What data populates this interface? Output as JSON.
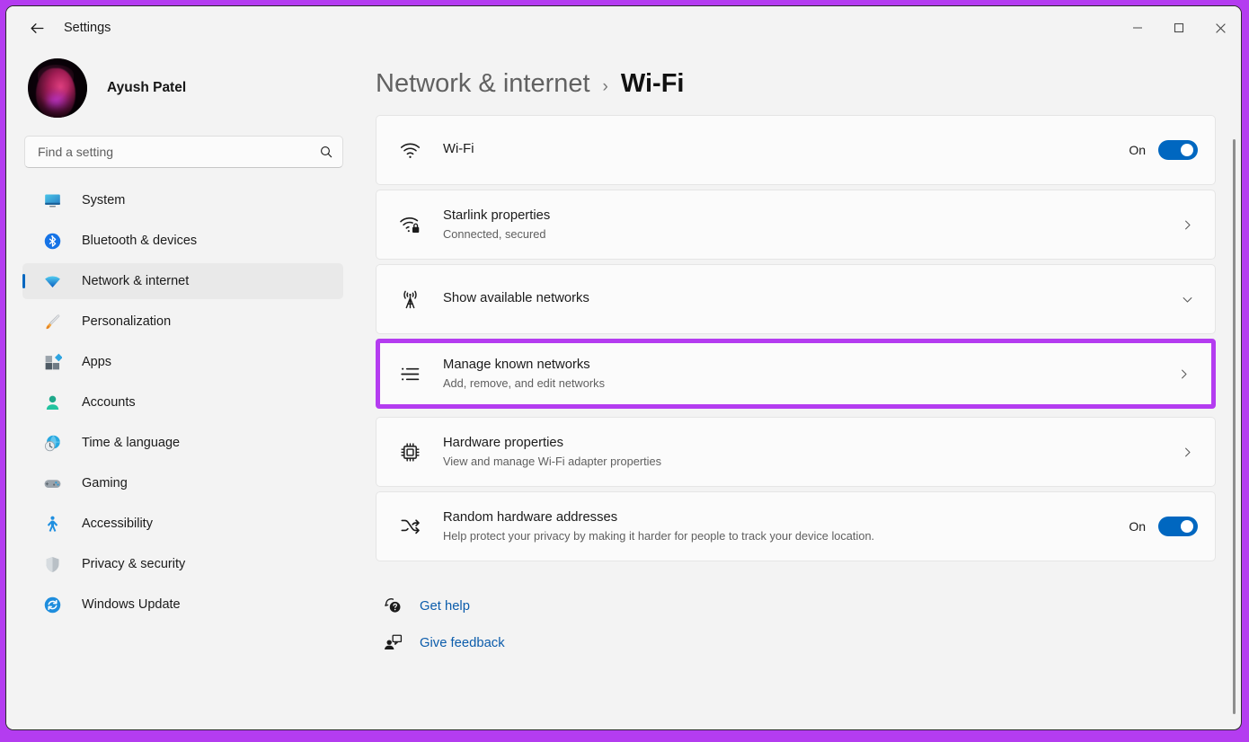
{
  "colors": {
    "highlight_purple": "#b43cf0",
    "accent_blue": "#0067c0",
    "link_blue": "#0b5cab",
    "window_bg": "#f3f3f3",
    "card_bg": "#fbfbfb"
  },
  "titlebar": {
    "back_icon": "back-arrow-icon",
    "title": "Settings",
    "minimize_label": "—",
    "maximize_label": "□",
    "close_label": "✕"
  },
  "sidebar": {
    "profile": {
      "name": "Ayush Patel",
      "avatar_icon": "user-avatar-photo"
    },
    "search": {
      "placeholder": "Find a setting",
      "value": "",
      "icon": "search-icon"
    },
    "items": [
      {
        "label": "System",
        "icon": "monitor-icon",
        "selected": false
      },
      {
        "label": "Bluetooth & devices",
        "icon": "bluetooth-icon",
        "selected": false
      },
      {
        "label": "Network & internet",
        "icon": "wifi-icon",
        "selected": true
      },
      {
        "label": "Personalization",
        "icon": "paintbrush-icon",
        "selected": false
      },
      {
        "label": "Apps",
        "icon": "apps-icon",
        "selected": false
      },
      {
        "label": "Accounts",
        "icon": "person-icon",
        "selected": false
      },
      {
        "label": "Time & language",
        "icon": "clock-globe-icon",
        "selected": false
      },
      {
        "label": "Gaming",
        "icon": "gamepad-icon",
        "selected": false
      },
      {
        "label": "Accessibility",
        "icon": "accessibility-icon",
        "selected": false
      },
      {
        "label": "Privacy & security",
        "icon": "shield-icon",
        "selected": false
      },
      {
        "label": "Windows Update",
        "icon": "update-refresh-icon",
        "selected": false
      }
    ]
  },
  "main": {
    "breadcrumb": {
      "parent": "Network & internet",
      "separator": "›",
      "current": "Wi-Fi"
    },
    "cards": [
      {
        "id": "wifi",
        "icon": "wifi-signal-icon",
        "title": "Wi-Fi",
        "subtitle": "",
        "control": "toggle",
        "toggle_state": "On",
        "highlighted": false
      },
      {
        "id": "starlink-properties",
        "icon": "wifi-lock-icon",
        "title": "Starlink properties",
        "subtitle": "Connected, secured",
        "control": "chevron-right",
        "toggle_state": "",
        "highlighted": false
      },
      {
        "id": "show-available-networks",
        "icon": "radio-tower-icon",
        "title": "Show available networks",
        "subtitle": "",
        "control": "chevron-down",
        "toggle_state": "",
        "highlighted": false
      },
      {
        "id": "manage-known-networks",
        "icon": "list-icon",
        "title": "Manage known networks",
        "subtitle": "Add, remove, and edit networks",
        "control": "chevron-right",
        "toggle_state": "",
        "highlighted": true
      },
      {
        "id": "hardware-properties",
        "icon": "chip-icon",
        "title": "Hardware properties",
        "subtitle": "View and manage Wi-Fi adapter properties",
        "control": "chevron-right",
        "toggle_state": "",
        "highlighted": false
      },
      {
        "id": "random-hardware-addresses",
        "icon": "shuffle-icon",
        "title": "Random hardware addresses",
        "subtitle": "Help protect your privacy by making it harder for people to track your device location.",
        "control": "toggle",
        "toggle_state": "On",
        "highlighted": false
      }
    ],
    "links": [
      {
        "label": "Get help",
        "icon": "help-question-icon"
      },
      {
        "label": "Give feedback",
        "icon": "feedback-person-icon"
      }
    ]
  }
}
